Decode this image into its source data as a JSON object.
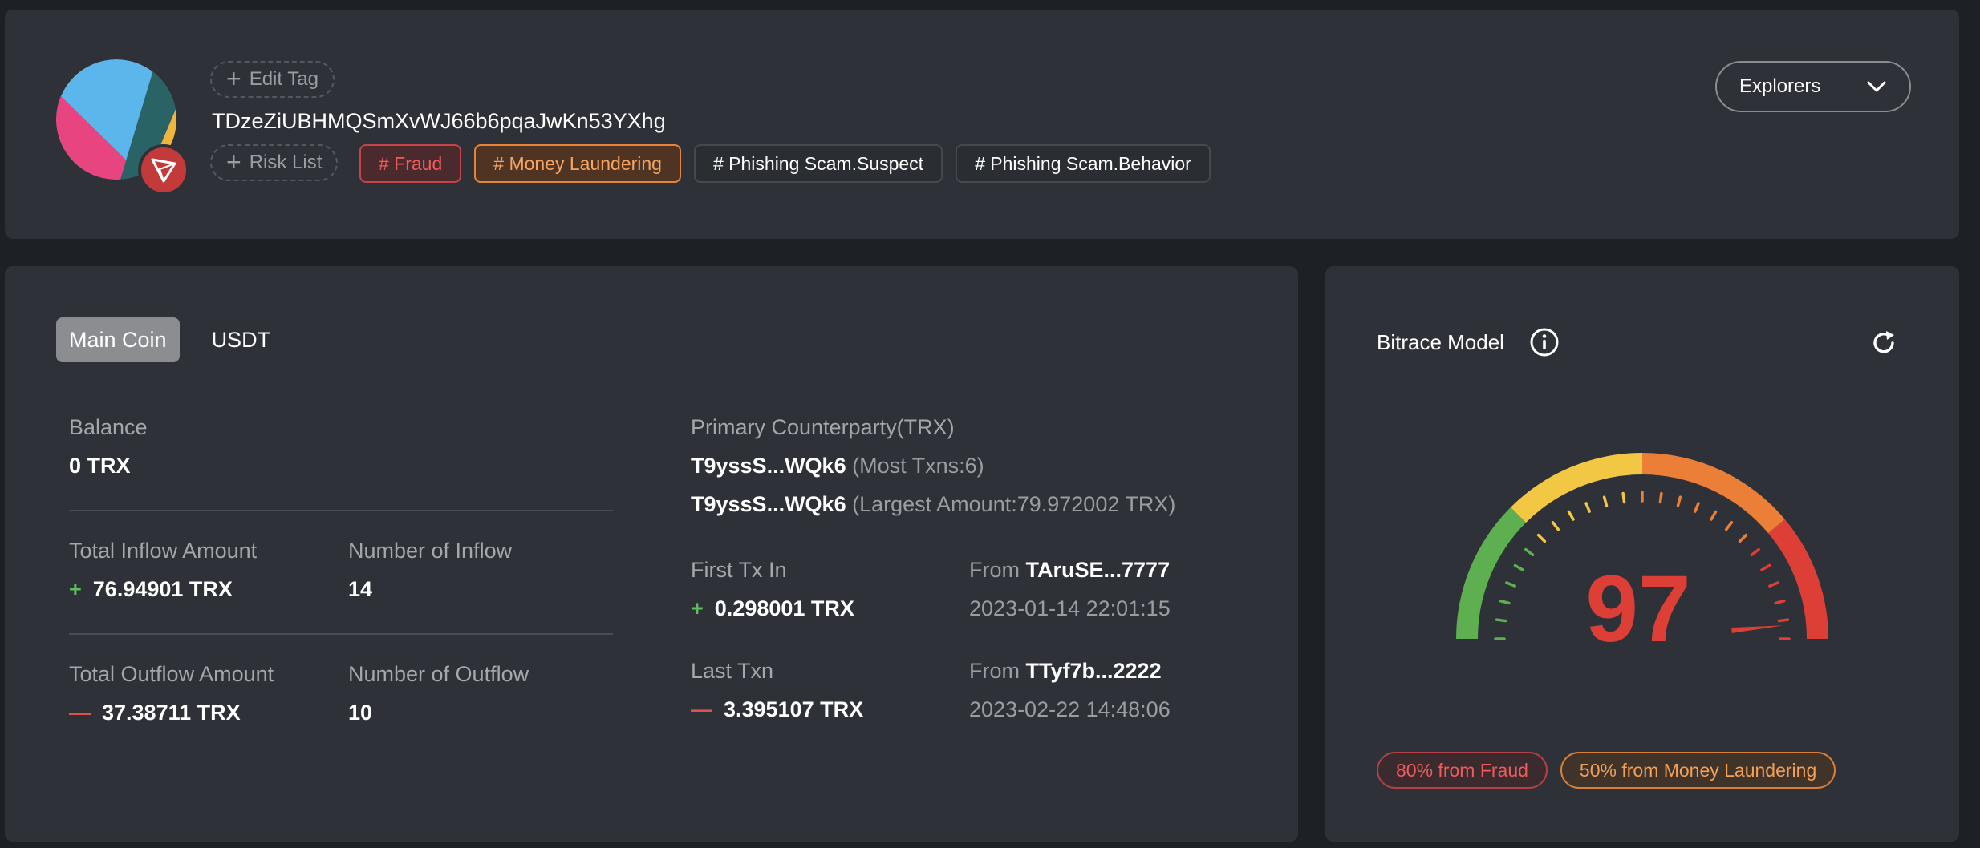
{
  "header": {
    "edit_tag_label": "Edit Tag",
    "address": "TDzeZiUBHMQSmXvWJ66b6pqaJwKn53YXhg",
    "risk_list_label": "Risk List",
    "tags": [
      {
        "label": "# Fraud",
        "style": "fraud"
      },
      {
        "label": "# Money Laundering",
        "style": "ml"
      },
      {
        "label": "# Phishing Scam.Suspect",
        "style": "neutral"
      },
      {
        "label": "# Phishing Scam.Behavior",
        "style": "neutral"
      }
    ],
    "explorers_label": "Explorers",
    "avatar_colors": [
      "#5bb6ec",
      "#e8447f",
      "#2a6366",
      "#f0b53a"
    ],
    "chain_icon": "tron-icon"
  },
  "tabs": [
    {
      "label": "Main Coin",
      "active": true
    },
    {
      "label": "USDT",
      "active": false
    }
  ],
  "stats": {
    "balance_label": "Balance",
    "balance_value": "0 TRX",
    "inflow_amount_label": "Total Inflow Amount",
    "inflow_amount_value": "76.94901 TRX",
    "inflow_count_label": "Number of Inflow",
    "inflow_count_value": "14",
    "outflow_amount_label": "Total Outflow Amount",
    "outflow_amount_value": "37.38711 TRX",
    "outflow_count_label": "Number of Outflow",
    "outflow_count_value": "10"
  },
  "counterparty": {
    "label": "Primary Counterparty(TRX)",
    "rows": [
      {
        "address": "T9yssS...WQk6",
        "note": "(Most Txns:6)"
      },
      {
        "address": "T9yssS...WQk6",
        "note": "(Largest Amount:79.972002 TRX)"
      }
    ]
  },
  "first_tx": {
    "label": "First Tx In",
    "amount": "0.298001 TRX",
    "from_label": "From",
    "from_address": "TAruSE...7777",
    "time": "2023-01-14 22:01:15"
  },
  "last_tx": {
    "label": "Last Txn",
    "amount": "3.395107 TRX",
    "from_label": "From",
    "from_address": "TTyf7b...2222",
    "time": "2023-02-22 14:48:06"
  },
  "model": {
    "title": "Bitrace Model",
    "score": "97",
    "score_max": 100,
    "gauge_colors": [
      "#5daf4f",
      "#f2c744",
      "#ec7f38",
      "#dd3f37"
    ],
    "score_color": "#dd3f37",
    "risk_chips": [
      {
        "label": "80% from Fraud",
        "style": "fraud"
      },
      {
        "label": "50% from Money Laundering",
        "style": "ml"
      }
    ]
  }
}
